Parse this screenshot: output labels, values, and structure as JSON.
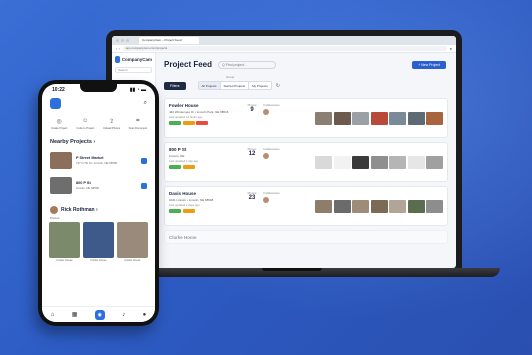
{
  "colors": {
    "accent": "#2e6fe0",
    "background": "#2d5cc4"
  },
  "browser": {
    "tab_title": "CompanyCam – Project Feed",
    "url": "app.companycam.com/projects"
  },
  "sidebar": {
    "brand": "CompanyCam",
    "search_placeholder": "Search"
  },
  "feed": {
    "title": "Project Feed",
    "search_placeholder": "Q Find project...",
    "new_button": "+ New Project",
    "filters_button": "Filters",
    "group_label": "Group",
    "segments": [
      "All Projects",
      "Starred Projects",
      "My Projects"
    ],
    "refresh_icon": "refresh-icon",
    "projects": [
      {
        "name": "Fowler House",
        "address": "440 Windemere Dr • Lincoln Park, NE 68516",
        "updated": "Last updated 14 hours ago",
        "photos_label": "Photos",
        "photos": "9",
        "members_label": "Collaborators",
        "tags": [
          "#4caf50",
          "#f39c12",
          "#e74c3c"
        ],
        "thumbs": [
          "#8a7f72",
          "#6d5a4e",
          "#9aa0a6",
          "#b74a3a",
          "#7a8a96",
          "#5f6b74",
          "#a8643f"
        ]
      },
      {
        "name": "800 P St",
        "address": "Lincoln, NE",
        "updated": "Last updated 1 day ago",
        "photos_label": "Photos",
        "photos": "12",
        "members_label": "Collaborators",
        "tags": [
          "#4caf50",
          "#f39c12"
        ],
        "thumbs": [
          "#d9d9d9",
          "#f2f2f2",
          "#3a3a3a",
          "#8f8f8f",
          "#b5b5b5",
          "#e6e6e6",
          "#a0a0a0"
        ]
      },
      {
        "name": "Davis House",
        "address": "1021 Lincoln • Lincoln, NE 68508",
        "updated": "Last updated 2 days ago",
        "photos_label": "Photos",
        "photos": "23",
        "members_label": "Collaborators",
        "tags": [
          "#4caf50",
          "#f39c12"
        ],
        "thumbs": [
          "#8d7d6a",
          "#6b6b6b",
          "#9c8c78",
          "#7c6a55",
          "#b0a597",
          "#5a6d4e",
          "#8d8d8d"
        ]
      },
      {
        "name": "Clarke Home",
        "address": "",
        "updated": "",
        "photos_label": "",
        "photos": "",
        "members_label": "",
        "tags": [],
        "thumbs": []
      }
    ]
  },
  "phone": {
    "time": "10:22",
    "status_icons": "▮▮ ◔ ▬",
    "search_icon": "search-icon",
    "quick_actions": [
      {
        "icon": "camera-icon",
        "label": "Create Project"
      },
      {
        "icon": "users-icon",
        "label": "Invite to Project"
      },
      {
        "icon": "upload-icon",
        "label": "Upload Photos"
      },
      {
        "icon": "scan-icon",
        "label": "Scan Document"
      }
    ],
    "nearby_title": "Nearby Projects ›",
    "nearby": [
      {
        "name": "P Street Market",
        "address": "737 N 7th St • Lincoln, NE 68508",
        "img": "#8c6f5a"
      },
      {
        "name": "800 P St",
        "address": "Lincoln, NE 68508",
        "img": "#6e6e6e"
      }
    ],
    "user_name": "Rick Rothman ›",
    "photos_label": "Photos",
    "photos": [
      {
        "caption": "Fowler House",
        "color": "#7a8a6a"
      },
      {
        "caption": "Fowler House",
        "color": "#3d5a8a"
      },
      {
        "caption": "Fowler House",
        "color": "#9a8a7a"
      }
    ],
    "tabs": [
      "home-icon",
      "gallery-icon",
      "camera-icon",
      "bell-icon",
      "profile-icon"
    ]
  }
}
